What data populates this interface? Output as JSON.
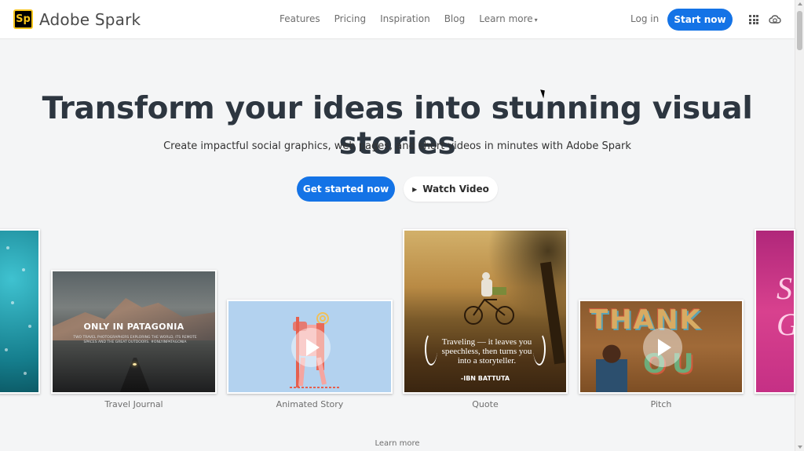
{
  "header": {
    "logo_text": "Sp",
    "brand": "Adobe Spark",
    "nav": [
      {
        "label": "Features"
      },
      {
        "label": "Pricing"
      },
      {
        "label": "Inspiration"
      },
      {
        "label": "Blog"
      },
      {
        "label": "Learn more",
        "has_dropdown": true
      }
    ],
    "login": "Log in",
    "start_now": "Start now",
    "accent_color": "#1473e6",
    "logo_border_color": "#f7c51a"
  },
  "hero": {
    "title": "Transform your ideas into stunning visual stories",
    "subtitle": "Create impactful social graphics, web pages, and short videos in minutes with Adobe Spark",
    "primary_cta": "Get started now",
    "secondary_cta": "Watch Video"
  },
  "cards": [
    {
      "label": "Travel Journal",
      "title": "ONLY IN PATAGONIA",
      "body": "TWO TRAVEL PHOTOGRAPHERS EXPLORING THE WORLD, ITS REMOTE SPACES AND THE GREAT OUTDOORS. #ONLYINPATAGONIA"
    },
    {
      "label": "Animated Story"
    },
    {
      "label": "Quote",
      "quote": "Traveling — it leaves you speechless, then turns you into a storyteller.",
      "author": "-IBN BATTUTA"
    },
    {
      "label": "Pitch",
      "letters_top": "THANK",
      "letters_bottom": "OU"
    }
  ],
  "edge_card_right_letters": [
    "S",
    "G"
  ],
  "learn_more": "Learn more"
}
